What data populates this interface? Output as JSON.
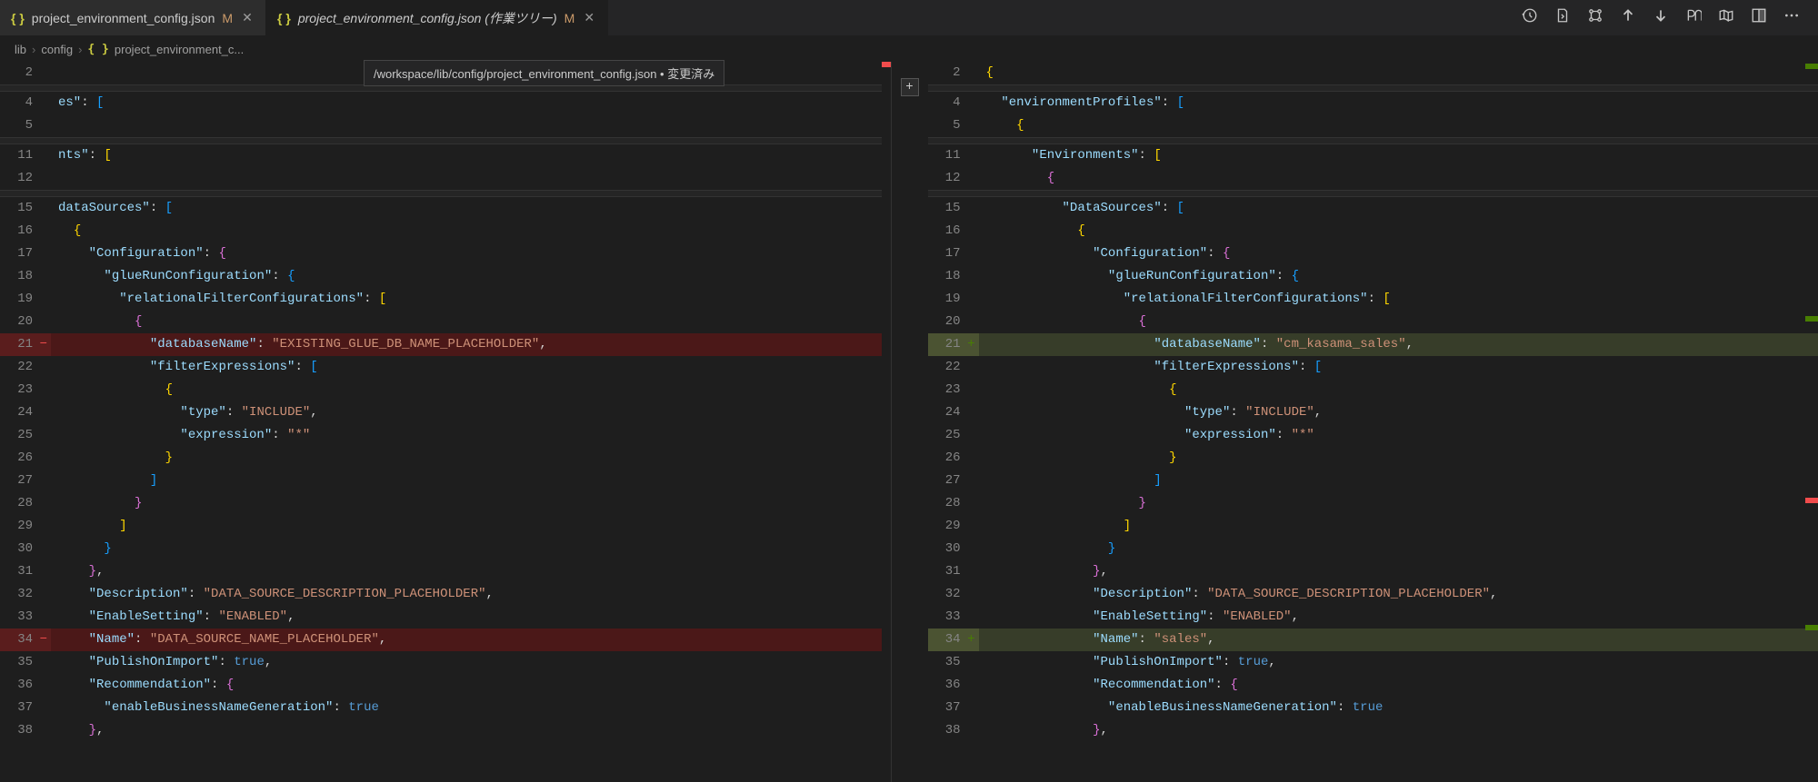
{
  "tabs": [
    {
      "label": "project_environment_config.json",
      "modified": "M",
      "active": false
    },
    {
      "label": "project_environment_config.json (作業ツリー)",
      "modified": "M",
      "active": true
    }
  ],
  "toolbar": {
    "history": "history",
    "openFile": "open-file",
    "settings": "diff-settings",
    "prevChange": "previous-change",
    "nextChange": "next-change",
    "whitespace": "show-whitespace",
    "map": "map",
    "splitRight": "split-right",
    "more": "more"
  },
  "breadcrumbs": {
    "parts": [
      "lib",
      "config",
      "project_environment_c..."
    ]
  },
  "tooltip": "/workspace/lib/config/project_environment_config.json • 変更済み",
  "left": {
    "lines": [
      {
        "n": 2,
        "ind": 0,
        "content": ""
      },
      {
        "n": 4,
        "ind": 0,
        "tokens": [
          [
            "s-key",
            "es\""
          ],
          [
            "s-punc",
            ": "
          ],
          [
            "s-bracket3",
            "["
          ]
        ]
      },
      {
        "n": 5,
        "ind": 0,
        "content": ""
      },
      {
        "n": 11,
        "ind": 0,
        "tokens": [
          [
            "s-key",
            "nts\""
          ],
          [
            "s-punc",
            ": "
          ],
          [
            "s-bracket",
            "["
          ]
        ]
      },
      {
        "n": 12,
        "ind": 0,
        "content": ""
      },
      {
        "n": 15,
        "ind": 0,
        "tokens": [
          [
            "s-key",
            "dataSources\""
          ],
          [
            "s-punc",
            ": "
          ],
          [
            "s-bracket3",
            "["
          ]
        ]
      },
      {
        "n": 16,
        "ind": 1,
        "tokens": [
          [
            "s-bracket",
            "{"
          ]
        ]
      },
      {
        "n": 17,
        "ind": 2,
        "tokens": [
          [
            "s-key",
            "\"Configuration\""
          ],
          [
            "s-punc",
            ": "
          ],
          [
            "s-bracket2",
            "{"
          ]
        ]
      },
      {
        "n": 18,
        "ind": 3,
        "tokens": [
          [
            "s-key",
            "\"glueRunConfiguration\""
          ],
          [
            "s-punc",
            ": "
          ],
          [
            "s-bracket3",
            "{"
          ]
        ]
      },
      {
        "n": 19,
        "ind": 4,
        "tokens": [
          [
            "s-key",
            "\"relationalFilterConfigurations\""
          ],
          [
            "s-punc",
            ": "
          ],
          [
            "s-bracket",
            "["
          ]
        ]
      },
      {
        "n": 20,
        "ind": 5,
        "tokens": [
          [
            "s-bracket2",
            "{"
          ]
        ]
      },
      {
        "n": 21,
        "ind": 6,
        "diff": "del",
        "tokens": [
          [
            "s-key",
            "\"databaseName\""
          ],
          [
            "s-punc",
            ": "
          ],
          [
            "s-str",
            "\"EXISTING_GLUE_DB_NAME_PLACEHOLDER\""
          ],
          [
            "s-punc",
            ","
          ]
        ]
      },
      {
        "n": 22,
        "ind": 6,
        "tokens": [
          [
            "s-key",
            "\"filterExpressions\""
          ],
          [
            "s-punc",
            ": "
          ],
          [
            "s-bracket3",
            "["
          ]
        ]
      },
      {
        "n": 23,
        "ind": 7,
        "tokens": [
          [
            "s-bracket",
            "{"
          ]
        ]
      },
      {
        "n": 24,
        "ind": 8,
        "tokens": [
          [
            "s-key",
            "\"type\""
          ],
          [
            "s-punc",
            ": "
          ],
          [
            "s-str",
            "\"INCLUDE\""
          ],
          [
            "s-punc",
            ","
          ]
        ]
      },
      {
        "n": 25,
        "ind": 8,
        "tokens": [
          [
            "s-key",
            "\"expression\""
          ],
          [
            "s-punc",
            ": "
          ],
          [
            "s-str",
            "\"*\""
          ]
        ]
      },
      {
        "n": 26,
        "ind": 7,
        "tokens": [
          [
            "s-bracket",
            "}"
          ]
        ]
      },
      {
        "n": 27,
        "ind": 6,
        "tokens": [
          [
            "s-bracket3",
            "]"
          ]
        ]
      },
      {
        "n": 28,
        "ind": 5,
        "tokens": [
          [
            "s-bracket2",
            "}"
          ]
        ]
      },
      {
        "n": 29,
        "ind": 4,
        "tokens": [
          [
            "s-bracket",
            "]"
          ]
        ]
      },
      {
        "n": 30,
        "ind": 3,
        "tokens": [
          [
            "s-bracket3",
            "}"
          ]
        ]
      },
      {
        "n": 31,
        "ind": 2,
        "tokens": [
          [
            "s-bracket2",
            "}"
          ],
          [
            "s-punc",
            ","
          ]
        ]
      },
      {
        "n": 32,
        "ind": 2,
        "tokens": [
          [
            "s-key",
            "\"Description\""
          ],
          [
            "s-punc",
            ": "
          ],
          [
            "s-str",
            "\"DATA_SOURCE_DESCRIPTION_PLACEHOLDER\""
          ],
          [
            "s-punc",
            ","
          ]
        ]
      },
      {
        "n": 33,
        "ind": 2,
        "tokens": [
          [
            "s-key",
            "\"EnableSetting\""
          ],
          [
            "s-punc",
            ": "
          ],
          [
            "s-str",
            "\"ENABLED\""
          ],
          [
            "s-punc",
            ","
          ]
        ]
      },
      {
        "n": 34,
        "ind": 2,
        "diff": "del",
        "tokens": [
          [
            "s-key",
            "\"Name\""
          ],
          [
            "s-punc",
            ": "
          ],
          [
            "s-str",
            "\"DATA_SOURCE_NAME_PLACEHOLDER\""
          ],
          [
            "s-punc",
            ","
          ]
        ]
      },
      {
        "n": 35,
        "ind": 2,
        "tokens": [
          [
            "s-key",
            "\"PublishOnImport\""
          ],
          [
            "s-punc",
            ": "
          ],
          [
            "s-bool",
            "true"
          ],
          [
            "s-punc",
            ","
          ]
        ]
      },
      {
        "n": 36,
        "ind": 2,
        "tokens": [
          [
            "s-key",
            "\"Recommendation\""
          ],
          [
            "s-punc",
            ": "
          ],
          [
            "s-bracket2",
            "{"
          ]
        ]
      },
      {
        "n": 37,
        "ind": 3,
        "tokens": [
          [
            "s-key",
            "\"enableBusinessNameGeneration\""
          ],
          [
            "s-punc",
            ": "
          ],
          [
            "s-bool",
            "true"
          ]
        ]
      },
      {
        "n": 38,
        "ind": 2,
        "tokens": [
          [
            "s-bracket2",
            "}"
          ],
          [
            "s-punc",
            ","
          ]
        ]
      }
    ]
  },
  "right": {
    "lines": [
      {
        "n": 2,
        "ind": 0,
        "tokens": [
          [
            "s-bracket",
            "{"
          ]
        ]
      },
      {
        "n": 4,
        "ind": 1,
        "tokens": [
          [
            "s-key",
            "\"environmentProfiles\""
          ],
          [
            "s-punc",
            ": "
          ],
          [
            "s-bracket3",
            "["
          ]
        ]
      },
      {
        "n": 5,
        "ind": 2,
        "tokens": [
          [
            "s-bracket",
            "{"
          ]
        ]
      },
      {
        "n": 11,
        "ind": 3,
        "tokens": [
          [
            "s-key",
            "\"Environments\""
          ],
          [
            "s-punc",
            ": "
          ],
          [
            "s-bracket",
            "["
          ]
        ]
      },
      {
        "n": 12,
        "ind": 4,
        "tokens": [
          [
            "s-bracket2",
            "{"
          ]
        ]
      },
      {
        "n": 15,
        "ind": 5,
        "tokens": [
          [
            "s-key",
            "\"DataSources\""
          ],
          [
            "s-punc",
            ": "
          ],
          [
            "s-bracket3",
            "["
          ]
        ]
      },
      {
        "n": 16,
        "ind": 6,
        "tokens": [
          [
            "s-bracket",
            "{"
          ]
        ]
      },
      {
        "n": 17,
        "ind": 7,
        "tokens": [
          [
            "s-key",
            "\"Configuration\""
          ],
          [
            "s-punc",
            ": "
          ],
          [
            "s-bracket2",
            "{"
          ]
        ]
      },
      {
        "n": 18,
        "ind": 8,
        "tokens": [
          [
            "s-key",
            "\"glueRunConfiguration\""
          ],
          [
            "s-punc",
            ": "
          ],
          [
            "s-bracket3",
            "{"
          ]
        ]
      },
      {
        "n": 19,
        "ind": 9,
        "tokens": [
          [
            "s-key",
            "\"relationalFilterConfigurations\""
          ],
          [
            "s-punc",
            ": "
          ],
          [
            "s-bracket",
            "["
          ]
        ]
      },
      {
        "n": 20,
        "ind": 10,
        "tokens": [
          [
            "s-bracket2",
            "{"
          ]
        ]
      },
      {
        "n": 21,
        "ind": 11,
        "diff": "add",
        "tokens": [
          [
            "s-key",
            "\"databaseName\""
          ],
          [
            "s-punc",
            ": "
          ],
          [
            "s-str",
            "\"cm_kasama_sales\""
          ],
          [
            "s-punc",
            ","
          ]
        ]
      },
      {
        "n": 22,
        "ind": 11,
        "tokens": [
          [
            "s-key",
            "\"filterExpressions\""
          ],
          [
            "s-punc",
            ": "
          ],
          [
            "s-bracket3",
            "["
          ]
        ]
      },
      {
        "n": 23,
        "ind": 12,
        "tokens": [
          [
            "s-bracket",
            "{"
          ]
        ]
      },
      {
        "n": 24,
        "ind": 13,
        "tokens": [
          [
            "s-key",
            "\"type\""
          ],
          [
            "s-punc",
            ": "
          ],
          [
            "s-str",
            "\"INCLUDE\""
          ],
          [
            "s-punc",
            ","
          ]
        ]
      },
      {
        "n": 25,
        "ind": 13,
        "tokens": [
          [
            "s-key",
            "\"expression\""
          ],
          [
            "s-punc",
            ": "
          ],
          [
            "s-str",
            "\"*\""
          ]
        ]
      },
      {
        "n": 26,
        "ind": 12,
        "tokens": [
          [
            "s-bracket",
            "}"
          ]
        ]
      },
      {
        "n": 27,
        "ind": 11,
        "tokens": [
          [
            "s-bracket3",
            "]"
          ]
        ]
      },
      {
        "n": 28,
        "ind": 10,
        "tokens": [
          [
            "s-bracket2",
            "}"
          ]
        ]
      },
      {
        "n": 29,
        "ind": 9,
        "tokens": [
          [
            "s-bracket",
            "]"
          ]
        ]
      },
      {
        "n": 30,
        "ind": 8,
        "tokens": [
          [
            "s-bracket3",
            "}"
          ]
        ]
      },
      {
        "n": 31,
        "ind": 7,
        "tokens": [
          [
            "s-bracket2",
            "}"
          ],
          [
            "s-punc",
            ","
          ]
        ]
      },
      {
        "n": 32,
        "ind": 7,
        "tokens": [
          [
            "s-key",
            "\"Description\""
          ],
          [
            "s-punc",
            ": "
          ],
          [
            "s-str",
            "\"DATA_SOURCE_DESCRIPTION_PLACEHOLDER\""
          ],
          [
            "s-punc",
            ","
          ]
        ]
      },
      {
        "n": 33,
        "ind": 7,
        "tokens": [
          [
            "s-key",
            "\"EnableSetting\""
          ],
          [
            "s-punc",
            ": "
          ],
          [
            "s-str",
            "\"ENABLED\""
          ],
          [
            "s-punc",
            ","
          ]
        ]
      },
      {
        "n": 34,
        "ind": 7,
        "diff": "add",
        "tokens": [
          [
            "s-key",
            "\"Name\""
          ],
          [
            "s-punc",
            ": "
          ],
          [
            "s-str",
            "\"sales\""
          ],
          [
            "s-punc",
            ","
          ]
        ]
      },
      {
        "n": 35,
        "ind": 7,
        "tokens": [
          [
            "s-key",
            "\"PublishOnImport\""
          ],
          [
            "s-punc",
            ": "
          ],
          [
            "s-bool",
            "true"
          ],
          [
            "s-punc",
            ","
          ]
        ]
      },
      {
        "n": 36,
        "ind": 7,
        "tokens": [
          [
            "s-key",
            "\"Recommendation\""
          ],
          [
            "s-punc",
            ": "
          ],
          [
            "s-bracket2",
            "{"
          ]
        ]
      },
      {
        "n": 37,
        "ind": 8,
        "tokens": [
          [
            "s-key",
            "\"enableBusinessNameGeneration\""
          ],
          [
            "s-punc",
            ": "
          ],
          [
            "s-bool",
            "true"
          ]
        ]
      },
      {
        "n": 38,
        "ind": 7,
        "tokens": [
          [
            "s-bracket2",
            "}"
          ],
          [
            "s-punc",
            ","
          ]
        ]
      }
    ]
  }
}
